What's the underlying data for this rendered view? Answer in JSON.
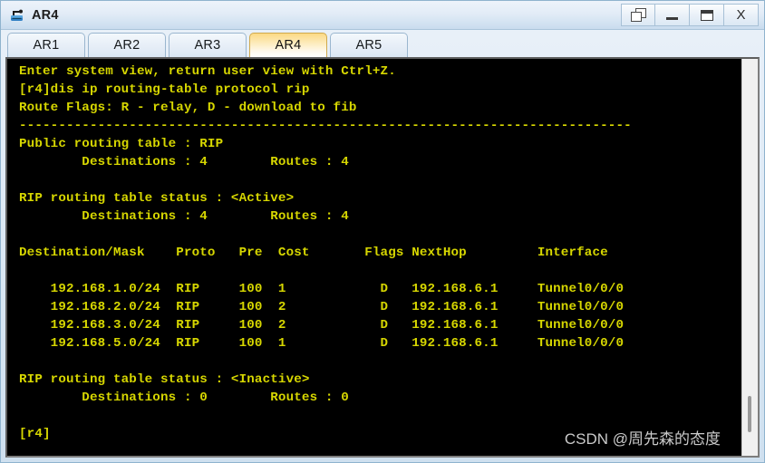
{
  "window": {
    "title": "AR4",
    "icon": "router-icon",
    "controls": [
      {
        "name": "restore-windows-button",
        "icon": "restore-icon",
        "label": ""
      },
      {
        "name": "minimize-button",
        "icon": "minimize-icon",
        "label": ""
      },
      {
        "name": "maximize-button",
        "icon": "maximize-icon",
        "label": ""
      },
      {
        "name": "close-button",
        "icon": "close-icon",
        "label": "X"
      }
    ]
  },
  "tabs": [
    {
      "label": "AR1",
      "active": false
    },
    {
      "label": "AR2",
      "active": false
    },
    {
      "label": "AR3",
      "active": false
    },
    {
      "label": "AR4",
      "active": true
    },
    {
      "label": "AR5",
      "active": false
    }
  ],
  "terminal": {
    "foreground": "#d7d700",
    "background": "#000000",
    "lines": [
      "Enter system view, return user view with Ctrl+Z.",
      "[r4]dis ip routing-table protocol rip",
      "Route Flags: R - relay, D - download to fib",
      "------------------------------------------------------------------------------",
      "Public routing table : RIP",
      "        Destinations : 4        Routes : 4",
      "",
      "RIP routing table status : <Active>",
      "        Destinations : 4        Routes : 4",
      "",
      "Destination/Mask    Proto   Pre  Cost       Flags NextHop         Interface",
      "",
      "    192.168.1.0/24  RIP     100  1            D   192.168.6.1     Tunnel0/0/0",
      "    192.168.2.0/24  RIP     100  2            D   192.168.6.1     Tunnel0/0/0",
      "    192.168.3.0/24  RIP     100  2            D   192.168.6.1     Tunnel0/0/0",
      "    192.168.5.0/24  RIP     100  1            D   192.168.6.1     Tunnel0/0/0",
      "",
      "RIP routing table status : <Inactive>",
      "        Destinations : 0        Routes : 0",
      "",
      "[r4]"
    ],
    "command": "dis ip routing-table protocol rip",
    "prompt": "[r4]",
    "route_flags": {
      "R": "relay",
      "D": "download to fib"
    },
    "public_routing_table": {
      "protocol": "RIP",
      "destinations": "4",
      "routes": "4"
    },
    "active_table": {
      "status": "<Active>",
      "destinations": "4",
      "routes": "4",
      "columns": [
        "Destination/Mask",
        "Proto",
        "Pre",
        "Cost",
        "Flags",
        "NextHop",
        "Interface"
      ],
      "rows": [
        [
          "192.168.1.0/24",
          "RIP",
          "100",
          "1",
          "D",
          "192.168.6.1",
          "Tunnel0/0/0"
        ],
        [
          "192.168.2.0/24",
          "RIP",
          "100",
          "2",
          "D",
          "192.168.6.1",
          "Tunnel0/0/0"
        ],
        [
          "192.168.3.0/24",
          "RIP",
          "100",
          "2",
          "D",
          "192.168.6.1",
          "Tunnel0/0/0"
        ],
        [
          "192.168.5.0/24",
          "RIP",
          "100",
          "1",
          "D",
          "192.168.6.1",
          "Tunnel0/0/0"
        ]
      ]
    },
    "inactive_table": {
      "status": "<Inactive>",
      "destinations": "0",
      "routes": "0"
    }
  },
  "watermark": {
    "text": "CSDN @周先森的态度"
  }
}
